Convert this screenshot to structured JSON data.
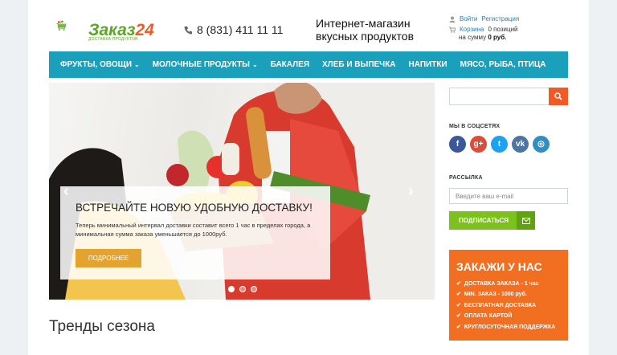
{
  "colors": {
    "nav": "#1ba0bc",
    "accent": "#f15a24",
    "green": "#7cc11d",
    "order_bg": "#f26f21",
    "more_btn": "#e3a32e"
  },
  "header": {
    "logo_text": "Заказ",
    "logo_num": "24",
    "logo_sub": "ДОСТАВКА ПРОДУКТОВ",
    "phone": "8 (831) 411 11 11",
    "tagline_1": "Интернет-магазин",
    "tagline_2": "вкусных продуктов",
    "login": "Войти",
    "register": "Регистрация",
    "cart_label": "Корзина",
    "cart_items": "0 позиций",
    "cart_sum_prefix": "на сумму",
    "cart_sum": "0 руб."
  },
  "nav": {
    "items": [
      {
        "label": "ФРУКТЫ, ОВОЩИ",
        "dropdown": "true"
      },
      {
        "label": "МОЛОЧНЫЕ ПРОДУКТЫ",
        "dropdown": "true"
      },
      {
        "label": "БАКАЛЕЯ"
      },
      {
        "label": "ХЛЕБ И ВЫПЕЧКА"
      },
      {
        "label": "НАПИТКИ"
      },
      {
        "label": "МЯСО, РЫБА, ПТИЦА"
      }
    ]
  },
  "slider": {
    "title": "ВСТРЕЧАЙТЕ НОВУЮ УДОБНУЮ ДОСТАВКУ!",
    "text": "Теперь минимальный интервал доставки составит всего 1 час в пределах города, а минимальная сумма заказа уменьшается до 1000руб.",
    "button": "ПОДРОБНЕЕ",
    "prev": "‹",
    "next": "›"
  },
  "main": {
    "section_title": "Тренды сезона"
  },
  "sidebar": {
    "social_heading": "МЫ В СОЦСЕТЯХ",
    "socials": [
      {
        "name": "facebook",
        "glyph": "f",
        "color": "#3b5998"
      },
      {
        "name": "google-plus",
        "glyph": "g+",
        "color": "#dd4b39"
      },
      {
        "name": "twitter",
        "glyph": "t",
        "color": "#1da1f2"
      },
      {
        "name": "vk",
        "glyph": "vk",
        "color": "#4c75a3"
      },
      {
        "name": "instagram",
        "glyph": "◎",
        "color": "#2f8ec2"
      }
    ],
    "newsletter_heading": "РАССЫЛКА",
    "email_placeholder": "Введите ваш e-mail",
    "subscribe": "ПОДПИСАТЬСЯ",
    "order_title": "ЗАКАЖИ У НАС",
    "order_items": [
      "ДОСТАВКА ЗАКАЗА - 1 час",
      "MIN. ЗАКАЗ - 1000 руб.",
      "БЕСПЛАТНАЯ ДОСТАВКА",
      "ОПЛАТА КАРТОЙ",
      "КРУГЛОСУТОЧНАЯ ПОДДЕРЖКА"
    ]
  }
}
